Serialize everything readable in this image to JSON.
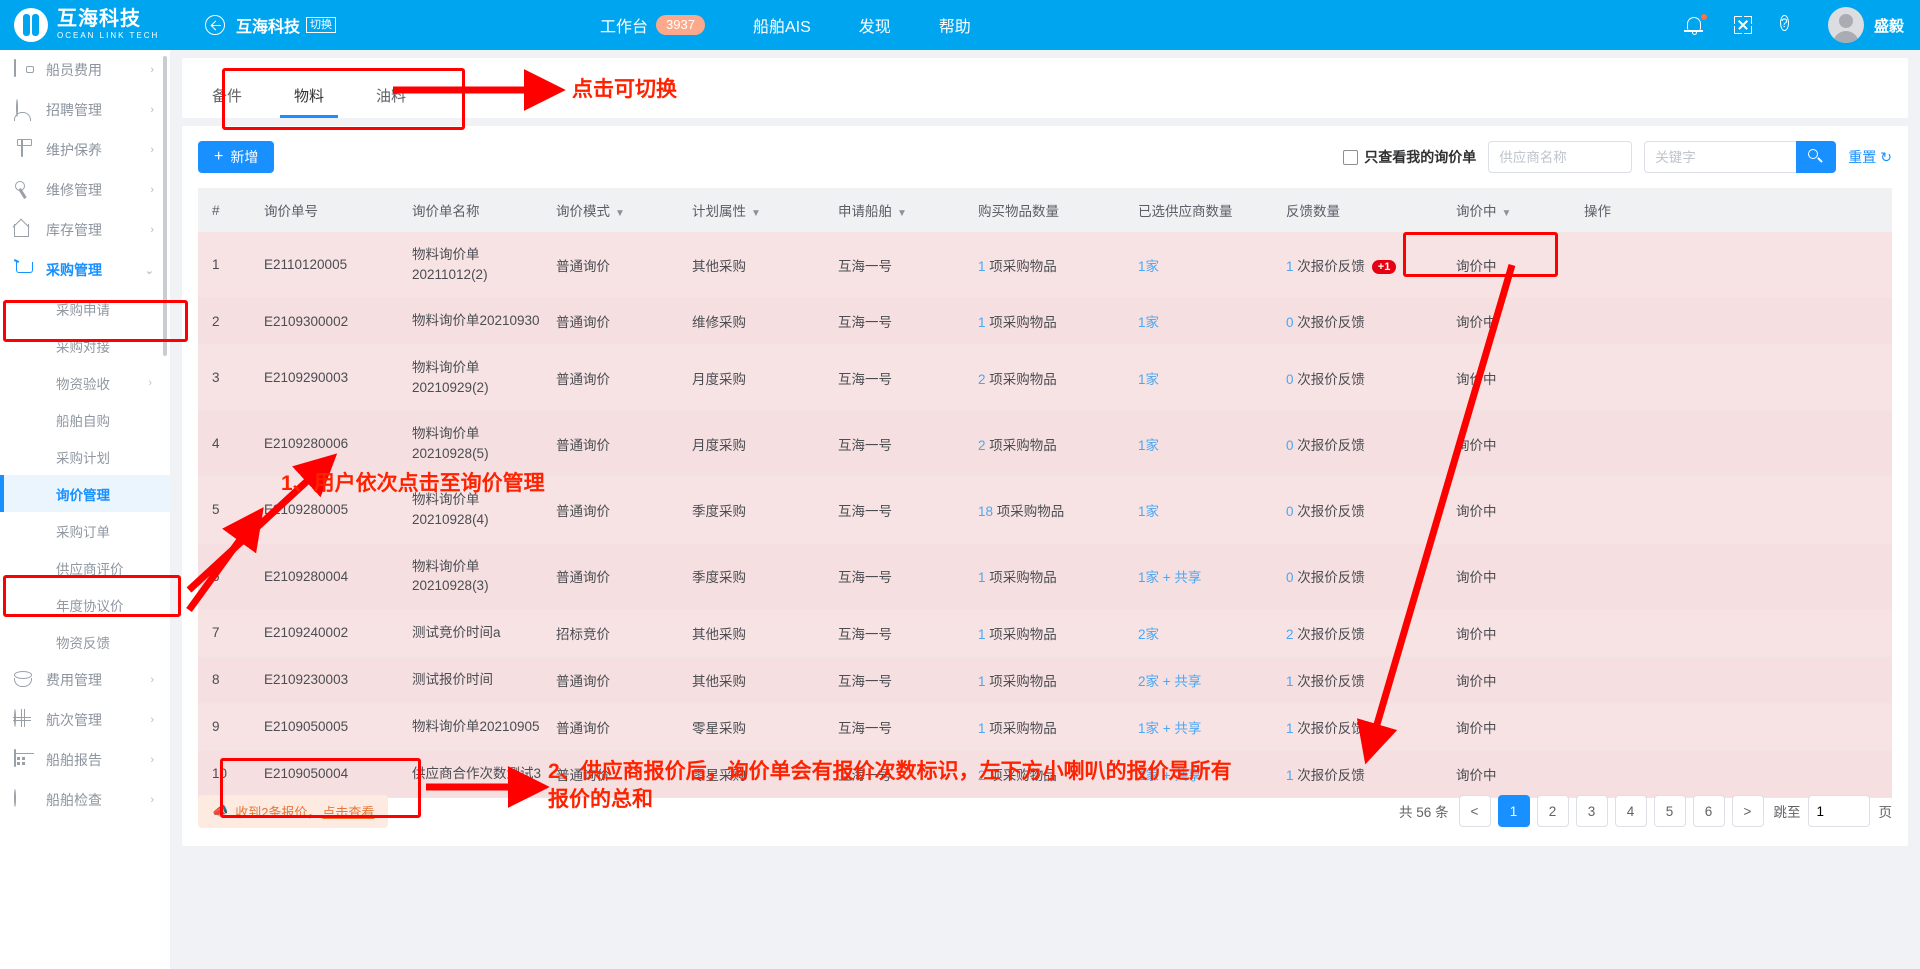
{
  "topbar": {
    "logo_cn": "互海科技",
    "logo_en": "OCEAN LINK TECH",
    "company": "互海科技",
    "switch_label": "切换",
    "nav": [
      {
        "label": "工作台",
        "badge": "3937"
      },
      {
        "label": "船舶AIS",
        "badge": ""
      },
      {
        "label": "发现",
        "badge": ""
      },
      {
        "label": "帮助",
        "badge": ""
      }
    ],
    "help_glyph": "?",
    "user_name": "盛毅"
  },
  "sidebar": {
    "items": [
      {
        "label": "船员费用",
        "icon": "wallet-icon",
        "chev": "›",
        "active": false
      },
      {
        "label": "招聘管理",
        "icon": "user-add-icon",
        "chev": "›",
        "active": false
      },
      {
        "label": "维护保养",
        "icon": "maintenance-icon",
        "chev": "›",
        "active": false
      },
      {
        "label": "维修管理",
        "icon": "wrench-icon",
        "chev": "›",
        "active": false
      },
      {
        "label": "库存管理",
        "icon": "home-icon",
        "chev": "›",
        "active": false
      },
      {
        "label": "采购管理",
        "icon": "cart-icon",
        "chev": "⌄",
        "active": true
      }
    ],
    "sub_items": [
      {
        "label": "采购申请",
        "chev": "",
        "active": false
      },
      {
        "label": "采购对接",
        "chev": "",
        "active": false
      },
      {
        "label": "物资验收",
        "chev": "›",
        "active": false
      },
      {
        "label": "船舶自购",
        "chev": "",
        "active": false
      },
      {
        "label": "采购计划",
        "chev": "",
        "active": false
      },
      {
        "label": "询价管理",
        "chev": "",
        "active": true
      },
      {
        "label": "采购订单",
        "chev": "",
        "active": false
      },
      {
        "label": "供应商评价",
        "chev": "",
        "active": false
      },
      {
        "label": "年度协议价",
        "chev": "",
        "active": false
      },
      {
        "label": "物资反馈",
        "chev": "",
        "active": false
      }
    ],
    "items_bottom": [
      {
        "label": "费用管理",
        "icon": "database-icon",
        "chev": "›",
        "active": false
      },
      {
        "label": "航次管理",
        "icon": "globe-icon",
        "chev": "›",
        "active": false
      },
      {
        "label": "船舶报告",
        "icon": "calendar-icon",
        "chev": "›",
        "active": false
      },
      {
        "label": "船舶检查",
        "icon": "ship-icon",
        "chev": "›",
        "active": false
      }
    ]
  },
  "tabs": [
    {
      "label": "备件",
      "active": false
    },
    {
      "label": "物料",
      "active": true
    },
    {
      "label": "油料",
      "active": false
    }
  ],
  "toolbar": {
    "add_label": "新增",
    "add_plus": "+",
    "checkbox_label": "只查看我的询价单",
    "supplier_placeholder": "供应商名称",
    "supplier_value": "",
    "keyword_placeholder": "关键字",
    "keyword_value": "",
    "reset_label": "重置",
    "reset_icon": "↻"
  },
  "table": {
    "headers": [
      {
        "label": "#",
        "caret": false
      },
      {
        "label": "询价单号",
        "caret": false
      },
      {
        "label": "询价单名称",
        "caret": false
      },
      {
        "label": "询价模式",
        "caret": true
      },
      {
        "label": "计划属性",
        "caret": true
      },
      {
        "label": "申请船舶",
        "caret": true
      },
      {
        "label": "购买物品数量",
        "caret": false
      },
      {
        "label": "已选供应商数量",
        "caret": false
      },
      {
        "label": "反馈数量",
        "caret": false
      },
      {
        "label": "询价中",
        "caret": true
      },
      {
        "label": "操作",
        "caret": false
      }
    ],
    "rows": [
      {
        "idx": "1",
        "no": "E2110120005",
        "name": "物料询价单20211012(2)",
        "mode": "普通询价",
        "attr": "其他采购",
        "ship": "互海一号",
        "qty_num": "1",
        "qty_unit": "项采购物品",
        "sup": "1家",
        "fb_num": "1",
        "fb_unit": "次报价反馈",
        "fb_badge": "+1",
        "status": "询价中",
        "op": ""
      },
      {
        "idx": "2",
        "no": "E2109300002",
        "name": "物料询价单20210930",
        "mode": "普通询价",
        "attr": "维修采购",
        "ship": "互海一号",
        "qty_num": "1",
        "qty_unit": "项采购物品",
        "sup": "1家",
        "fb_num": "0",
        "fb_unit": "次报价反馈",
        "fb_badge": "",
        "status": "询价中",
        "op": ""
      },
      {
        "idx": "3",
        "no": "E2109290003",
        "name": "物料询价单20210929(2)",
        "mode": "普通询价",
        "attr": "月度采购",
        "ship": "互海一号",
        "qty_num": "2",
        "qty_unit": "项采购物品",
        "sup": "1家",
        "fb_num": "0",
        "fb_unit": "次报价反馈",
        "fb_badge": "",
        "status": "询价中",
        "op": ""
      },
      {
        "idx": "4",
        "no": "E2109280006",
        "name": "物料询价单20210928(5)",
        "mode": "普通询价",
        "attr": "月度采购",
        "ship": "互海一号",
        "qty_num": "2",
        "qty_unit": "项采购物品",
        "sup": "1家",
        "fb_num": "0",
        "fb_unit": "次报价反馈",
        "fb_badge": "",
        "status": "询价中",
        "op": ""
      },
      {
        "idx": "5",
        "no": "E2109280005",
        "name": "物料询价单20210928(4)",
        "mode": "普通询价",
        "attr": "季度采购",
        "ship": "互海一号",
        "qty_num": "18",
        "qty_unit": "项采购物品",
        "sup": "1家",
        "fb_num": "0",
        "fb_unit": "次报价反馈",
        "fb_badge": "",
        "status": "询价中",
        "op": ""
      },
      {
        "idx": "6",
        "no": "E2109280004",
        "name": "物料询价单20210928(3)",
        "mode": "普通询价",
        "attr": "季度采购",
        "ship": "互海一号",
        "qty_num": "1",
        "qty_unit": "项采购物品",
        "sup": "1家 + 共享",
        "fb_num": "0",
        "fb_unit": "次报价反馈",
        "fb_badge": "",
        "status": "询价中",
        "op": ""
      },
      {
        "idx": "7",
        "no": "E2109240002",
        "name": "测试竞价时间a",
        "mode": "招标竞价",
        "attr": "其他采购",
        "ship": "互海一号",
        "qty_num": "1",
        "qty_unit": "项采购物品",
        "sup": "2家",
        "fb_num": "2",
        "fb_unit": "次报价反馈",
        "fb_badge": "",
        "status": "询价中",
        "op": ""
      },
      {
        "idx": "8",
        "no": "E2109230003",
        "name": "测试报价时间",
        "mode": "普通询价",
        "attr": "其他采购",
        "ship": "互海一号",
        "qty_num": "1",
        "qty_unit": "项采购物品",
        "sup": "2家 + 共享",
        "fb_num": "1",
        "fb_unit": "次报价反馈",
        "fb_badge": "",
        "status": "询价中",
        "op": ""
      },
      {
        "idx": "9",
        "no": "E2109050005",
        "name": "物料询价单20210905",
        "mode": "普通询价",
        "attr": "零星采购",
        "ship": "互海一号",
        "qty_num": "1",
        "qty_unit": "项采购物品",
        "sup": "1家 + 共享",
        "fb_num": "1",
        "fb_unit": "次报价反馈",
        "fb_badge": "",
        "status": "询价中",
        "op": ""
      },
      {
        "idx": "10",
        "no": "E2109050004",
        "name": "供应商合作次数测试3",
        "mode": "普通询价",
        "attr": "零星采购",
        "ship": "互海一号",
        "qty_num": "2",
        "qty_unit": "项采购物品",
        "sup": "1家 + 共享",
        "fb_num": "1",
        "fb_unit": "次报价反馈",
        "fb_badge": "",
        "status": "询价中",
        "op": ""
      }
    ]
  },
  "footer": {
    "notice_icon": "📣",
    "notice_text": "收到2条报价，",
    "notice_link": "点击查看",
    "total_text": "共 56 条",
    "prev": "<",
    "next": ">",
    "pages": [
      "1",
      "2",
      "3",
      "4",
      "5",
      "6"
    ],
    "current_page": "1",
    "jump_label": "跳至",
    "jump_value": "1",
    "page_unit": "页"
  },
  "annotations": {
    "tab_note": "点击可切换",
    "step1": "1、用户依次点击至询价管理",
    "step2": "2、供应商报价后，询价单会有报价次数标识，左下方小喇叭的报价是所有\n报价的总和"
  }
}
